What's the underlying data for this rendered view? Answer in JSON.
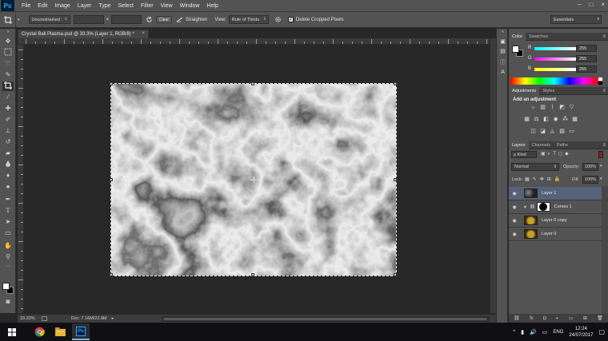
{
  "app": {
    "logo": "Ps",
    "menu": [
      "File",
      "Edit",
      "Image",
      "Layer",
      "Type",
      "Select",
      "Filter",
      "View",
      "Window",
      "Help"
    ],
    "window_controls": [
      "–",
      "□",
      "×"
    ]
  },
  "options_bar": {
    "tool_icon": "crop-icon",
    "ratio": "Unconstrained",
    "swap": "×",
    "clear_label": "Clear",
    "straighten_label": "Straighten",
    "view_label": "View:",
    "view_value": "Rule of Thirds",
    "delete_cropped_label": "Delete Cropped Pixels",
    "delete_cropped_checked": true,
    "workspace": "Essentials"
  },
  "document": {
    "tab_title": "Crystal Ball Plasma.psd @ 33.3% (Layer 1, RGB/8) *",
    "zoom": "33.33%",
    "doc_size": "Doc: 7.16M/22.8M"
  },
  "color_panel": {
    "tabs": [
      "Color",
      "Swatches"
    ],
    "channels": [
      {
        "label": "R",
        "value": "255"
      },
      {
        "label": "G",
        "value": "255"
      },
      {
        "label": "B",
        "value": "255"
      }
    ]
  },
  "adjustments_panel": {
    "tabs": [
      "Adjustments",
      "Styles"
    ],
    "heading": "Add an adjustment"
  },
  "layers_panel": {
    "tabs": [
      "Layers",
      "Channels",
      "Paths"
    ],
    "kind_label": "ρ Kind",
    "blend_mode": "Normal",
    "opacity_label": "Opacity:",
    "opacity": "100%",
    "lock_label": "Lock:",
    "fill_label": "Fill:",
    "fill": "100%",
    "layers": [
      {
        "name": "Layer 1",
        "thumb": "plasma",
        "selected": true
      },
      {
        "name": "Curves 1",
        "thumb": "curves-mask",
        "selected": false
      },
      {
        "name": "Layer 0 copy",
        "thumb": "crystal",
        "selected": false
      },
      {
        "name": "Layer 0",
        "thumb": "crystal",
        "selected": false
      }
    ]
  },
  "taskbar": {
    "apps": [
      "chrome-icon",
      "file-explorer-icon",
      "photoshop-icon"
    ],
    "language": "ENG",
    "time": "12:24",
    "date": "24/07/2017"
  },
  "colors": {
    "ui_dark": "#535353",
    "canvas_bg": "#282828",
    "selected_layer": "#56627a",
    "ps_blue": "#31a8ff"
  }
}
